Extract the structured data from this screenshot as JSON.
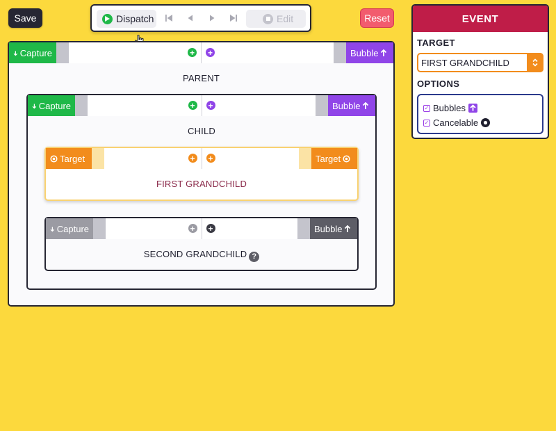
{
  "toolbar": {
    "save_label": "Save",
    "dispatch_label": "Dispatch",
    "edit_label": "Edit",
    "reset_label": "Reset"
  },
  "event_panel": {
    "title": "EVENT",
    "target_label": "TARGET",
    "target_value": "FIRST GRANDCHILD",
    "options_label": "OPTIONS",
    "options": [
      {
        "label": "Bubbles",
        "checked": true
      },
      {
        "label": "Cancelable",
        "checked": true
      }
    ]
  },
  "elements": {
    "parent": {
      "name": "PARENT",
      "capture_label": "Capture",
      "bubble_label": "Bubble"
    },
    "child": {
      "name": "CHILD",
      "capture_label": "Capture",
      "bubble_label": "Bubble"
    },
    "first_grandchild": {
      "name": "FIRST GRANDCHILD",
      "left_label": "Target",
      "right_label": "Target"
    },
    "second_grandchild": {
      "name": "SECOND GRANDCHILD",
      "capture_label": "Capture",
      "bubble_label": "Bubble"
    }
  },
  "colors": {
    "background": "#fcd93d",
    "capture": "#1fb848",
    "bubble": "#9045e8",
    "target": "#f28c1c",
    "event_header": "#bf1d48",
    "reset": "#f25c6e",
    "inactive": "#9b9ba3"
  },
  "icons": {
    "dispatch": "play-icon",
    "first": "skip-back-icon",
    "prev": "step-back-icon",
    "next": "step-forward-icon",
    "last": "skip-forward-icon",
    "edit": "stop-icon",
    "cursor": "hand-pointer-icon"
  }
}
